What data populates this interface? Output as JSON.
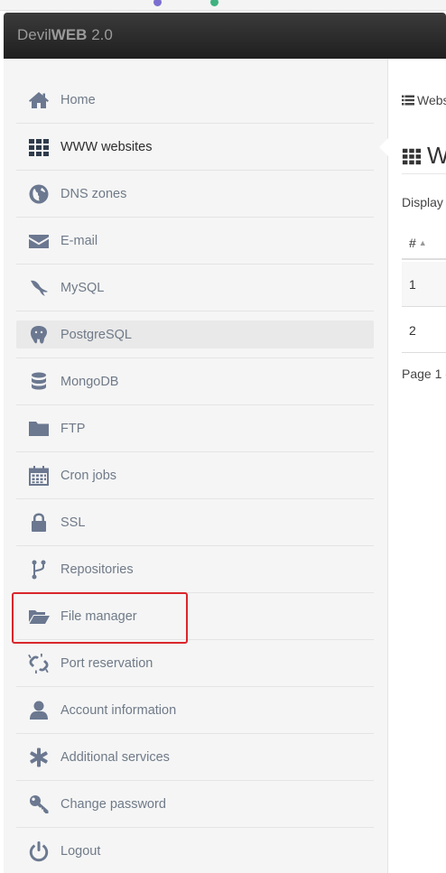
{
  "app": {
    "brand_light": "Devil",
    "brand_bold": "WEB",
    "brand_version": " 2.0"
  },
  "sidebar": {
    "items": [
      {
        "label": "Home",
        "icon": "home-icon"
      },
      {
        "label": "WWW websites",
        "icon": "grid-icon",
        "active": true
      },
      {
        "label": "DNS zones",
        "icon": "globe-icon"
      },
      {
        "label": "E-mail",
        "icon": "envelope-icon"
      },
      {
        "label": "MySQL",
        "icon": "mysql-dolphin-icon"
      },
      {
        "label": "PostgreSQL",
        "icon": "postgresql-elephant-icon",
        "hover": true
      },
      {
        "label": "MongoDB",
        "icon": "database-icon"
      },
      {
        "label": "FTP",
        "icon": "folder-icon"
      },
      {
        "label": "Cron jobs",
        "icon": "calendar-icon"
      },
      {
        "label": "SSL",
        "icon": "lock-icon"
      },
      {
        "label": "Repositories",
        "icon": "code-fork-icon"
      },
      {
        "label": "File manager",
        "icon": "folder-open-icon",
        "highlighted": true
      },
      {
        "label": "Port reservation",
        "icon": "chain-broken-icon"
      },
      {
        "label": "Account information",
        "icon": "user-icon"
      },
      {
        "label": "Additional services",
        "icon": "asterisk-icon"
      },
      {
        "label": "Change password",
        "icon": "key-icon"
      },
      {
        "label": "Logout",
        "icon": "power-icon"
      }
    ]
  },
  "main": {
    "breadcrumb": "Webs",
    "title": "W",
    "display_text": "Display",
    "table": {
      "header": "#",
      "rows": [
        "1",
        "2"
      ]
    },
    "pager_text": "Page 1 o"
  },
  "colors": {
    "highlight_border": "#d9262b",
    "navbar": "#2b2b2b",
    "sidebar_bg": "#f5f5f5",
    "icon": "#6b7890"
  }
}
